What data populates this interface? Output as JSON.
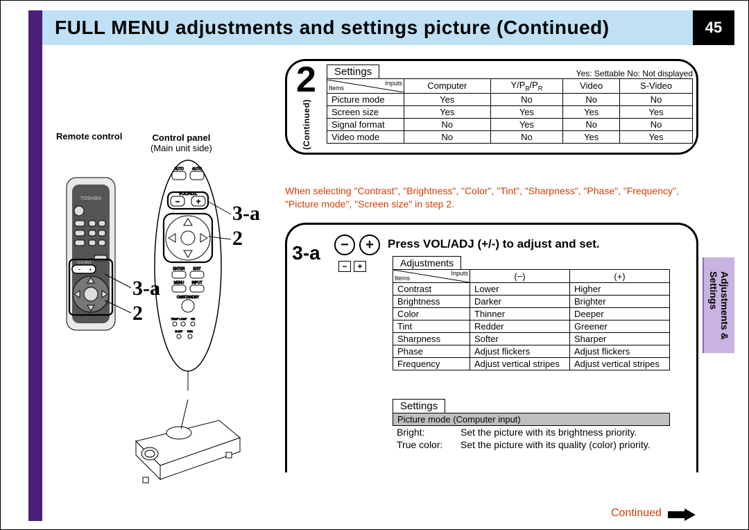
{
  "page": {
    "title": "FULL MENU adjustments and settings picture (Continued)",
    "number": "45"
  },
  "left_diagram": {
    "remote_label": "Remote control",
    "panel_label_bold": "Control panel",
    "panel_label_sub": "(Main unit side)",
    "callout_3a": "3-a",
    "callout_2": "2"
  },
  "step2": {
    "step_num": "2",
    "continued": "(Continued)",
    "tab_title": "Settings",
    "note": "Yes: Settable  No: Not displayed",
    "diag_items": "Items",
    "diag_inputs": "Inputs",
    "inputs": [
      "Computer",
      "Y/PB/PR",
      "Video",
      "S-Video"
    ],
    "rows": [
      {
        "item": "Picture mode",
        "vals": [
          "Yes",
          "No",
          "No",
          "No"
        ]
      },
      {
        "item": "Screen size",
        "vals": [
          "Yes",
          "Yes",
          "Yes",
          "Yes"
        ]
      },
      {
        "item": "Signal format",
        "vals": [
          "No",
          "Yes",
          "No",
          "No"
        ]
      },
      {
        "item": "Video mode",
        "vals": [
          "No",
          "No",
          "Yes",
          "Yes"
        ]
      }
    ]
  },
  "red_note": "When selecting \"Contrast\", \"Brightness\", \"Color\", \"Tint\", \"Sharpness\", \"Phase\", \"Frequency\", \"Picture mode\", \"Screen size\" in step 2.",
  "step3a": {
    "label": "3-a",
    "title": "Press VOL/ADJ (+/-) to adjust and set.",
    "tab_title": "Adjustments",
    "diag_items": "Items",
    "diag_inputs": "Inputs",
    "col_minus": "(−)",
    "col_plus": "(+)",
    "rows": [
      {
        "item": "Contrast",
        "minus": "Lower",
        "plus": "Higher"
      },
      {
        "item": "Brightness",
        "minus": "Darker",
        "plus": "Brighter"
      },
      {
        "item": "Color",
        "minus": "Thinner",
        "plus": "Deeper"
      },
      {
        "item": "Tint",
        "minus": "Redder",
        "plus": "Greener"
      },
      {
        "item": "Sharpness",
        "minus": "Softer",
        "plus": "Sharper"
      },
      {
        "item": "Phase",
        "minus": "Adjust flickers",
        "plus": "Adjust flickers"
      },
      {
        "item": "Frequency",
        "minus": "Adjust vertical stripes",
        "plus": "Adjust vertical stripes"
      }
    ],
    "settings_tab": "Settings",
    "picture_mode_header": "Picture mode (Computer input)",
    "picture_mode_rows": [
      {
        "k": "Bright:",
        "v": "Set the picture with its brightness priority."
      },
      {
        "k": "True color:",
        "v": "Set the picture with its quality (color) priority."
      }
    ]
  },
  "side_tab": {
    "line1": "Adjustments &",
    "line2": "Settings"
  },
  "footer_continued": "Continued"
}
